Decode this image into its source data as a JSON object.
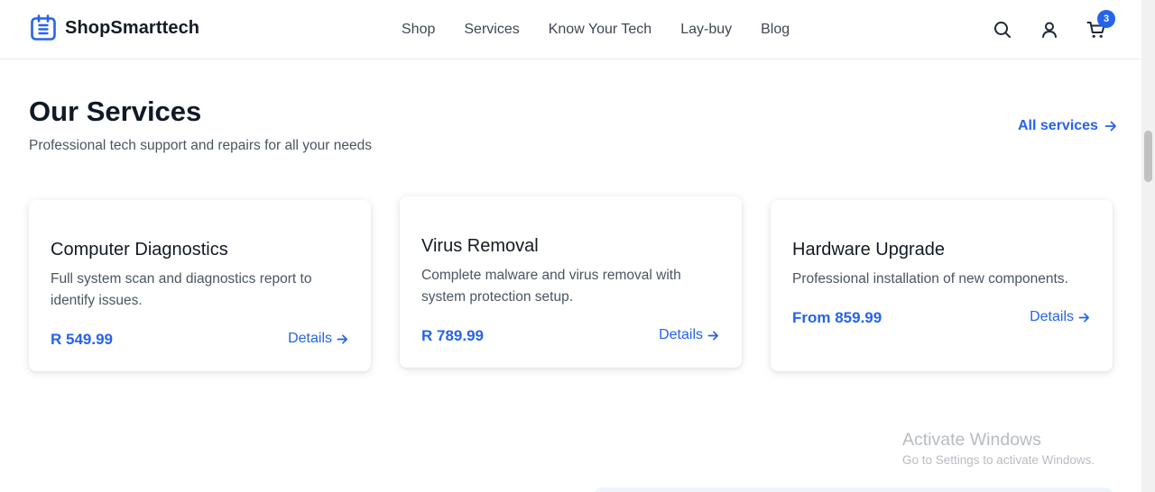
{
  "header": {
    "brand": "ShopSmarttech",
    "nav": [
      "Shop",
      "Services",
      "Know Your Tech",
      "Lay-buy",
      "Blog"
    ],
    "cart_count": "3"
  },
  "section": {
    "title": "Our Services",
    "subtitle": "Professional tech support and repairs for all your needs",
    "all_link": "All services"
  },
  "cards": [
    {
      "title": "Computer Diagnostics",
      "description": "Full system scan and diagnostics report to identify issues.",
      "price": "R 549.99",
      "link": "Details"
    },
    {
      "title": "Virus Removal",
      "description": "Complete malware and virus removal with system protection setup.",
      "price": "R 789.99",
      "link": "Details"
    },
    {
      "title": "Hardware Upgrade",
      "description": "Professional installation of new components.",
      "price": "From 859.99",
      "link": "Details"
    }
  ],
  "watermark": {
    "title": "Activate Windows",
    "subtitle": "Go to Settings to activate Windows."
  },
  "colors": {
    "accent": "#2563eb",
    "text": "#111827",
    "muted": "#4b5563"
  },
  "icons": {
    "brand": "calendar-logo-icon",
    "search": "search-icon",
    "account": "user-icon",
    "cart": "cart-icon",
    "arrow": "arrow-right-icon"
  }
}
